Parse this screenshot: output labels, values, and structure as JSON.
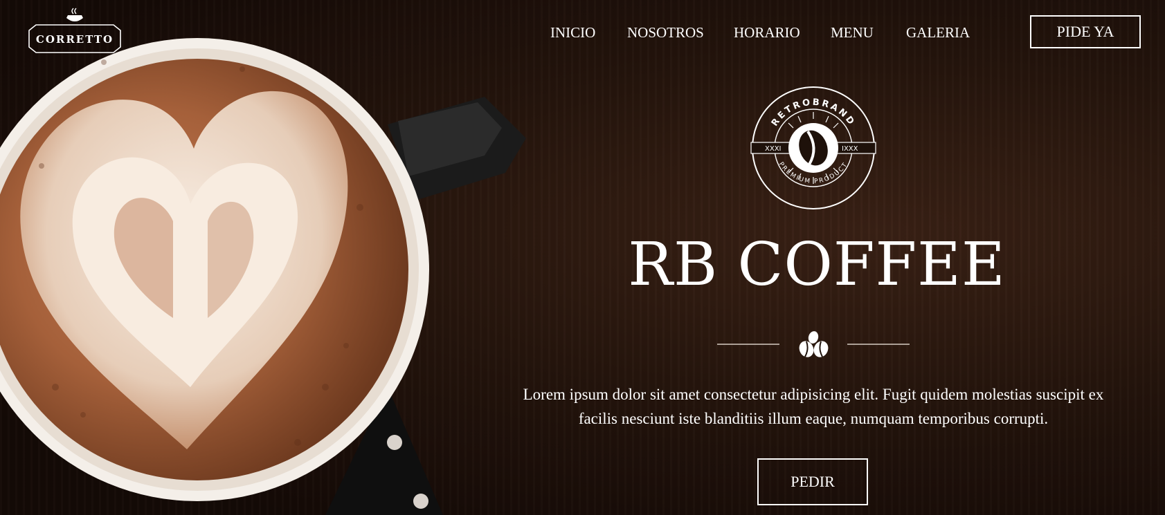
{
  "brand": {
    "logo_text": "CORRETTO"
  },
  "nav": {
    "items": [
      {
        "label": "INICIO"
      },
      {
        "label": "NOSOTROS"
      },
      {
        "label": "HORARIO"
      },
      {
        "label": "MENU"
      },
      {
        "label": "GALERIA"
      }
    ],
    "cta_label": "PIDE YA"
  },
  "hero": {
    "badge": {
      "top_text": "RETROBRAND",
      "bottom_text": "PREMIUM PRODUCT",
      "left_text": "XXXI",
      "right_text": "IXXX"
    },
    "title": "RB COFFEE",
    "description": "Lorem ipsum dolor sit amet consectetur adipisicing elit. Fugit quidem molestias suscipit ex facilis nesciunt iste blanditiis illum eaque, numquam temporibus corrupti.",
    "button_label": "PEDIR"
  },
  "colors": {
    "background": "#1a0e08",
    "foam": "#f1e3d6",
    "crema": "#a8643f",
    "text": "#ffffff"
  },
  "icons": {
    "logo": "coffee-cup-logo-icon",
    "badge": "coffee-bean-badge-icon",
    "divider": "coffee-beans-icon"
  }
}
